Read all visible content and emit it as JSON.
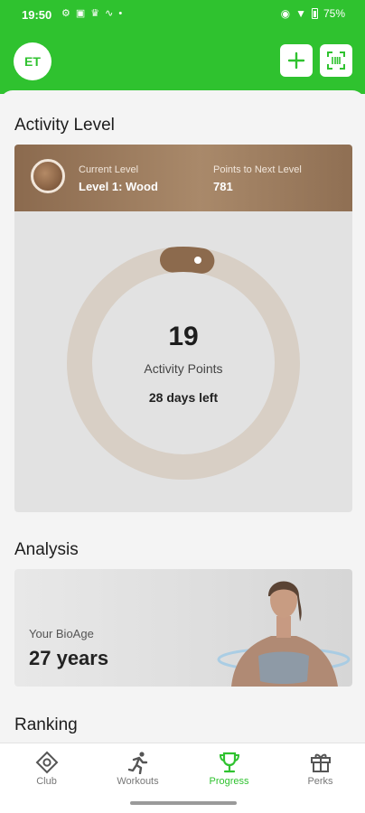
{
  "status_bar": {
    "time": "19:50",
    "battery": "75%"
  },
  "header": {
    "avatar_initials": "ET",
    "add_icon": "plus-icon",
    "scan_icon": "scan-icon",
    "accent": "#2fc22f"
  },
  "activity": {
    "title": "Activity Level",
    "current_level_label": "Current Level",
    "current_level_value": "Level 1: Wood",
    "points_next_label": "Points to Next Level",
    "points_next_value": "781",
    "points": "19",
    "points_label": "Activity Points",
    "days_left": "28 days left",
    "progress_fraction": 0.024
  },
  "analysis": {
    "title": "Analysis",
    "bioage_label": "Your BioAge",
    "bioage_value": "27 years"
  },
  "ranking": {
    "title": "Ranking"
  },
  "nav": [
    {
      "label": "Club",
      "icon": "target-icon",
      "active": false
    },
    {
      "label": "Workouts",
      "icon": "running-icon",
      "active": false
    },
    {
      "label": "Progress",
      "icon": "trophy-icon",
      "active": true
    },
    {
      "label": "Perks",
      "icon": "gift-icon",
      "active": false
    }
  ]
}
